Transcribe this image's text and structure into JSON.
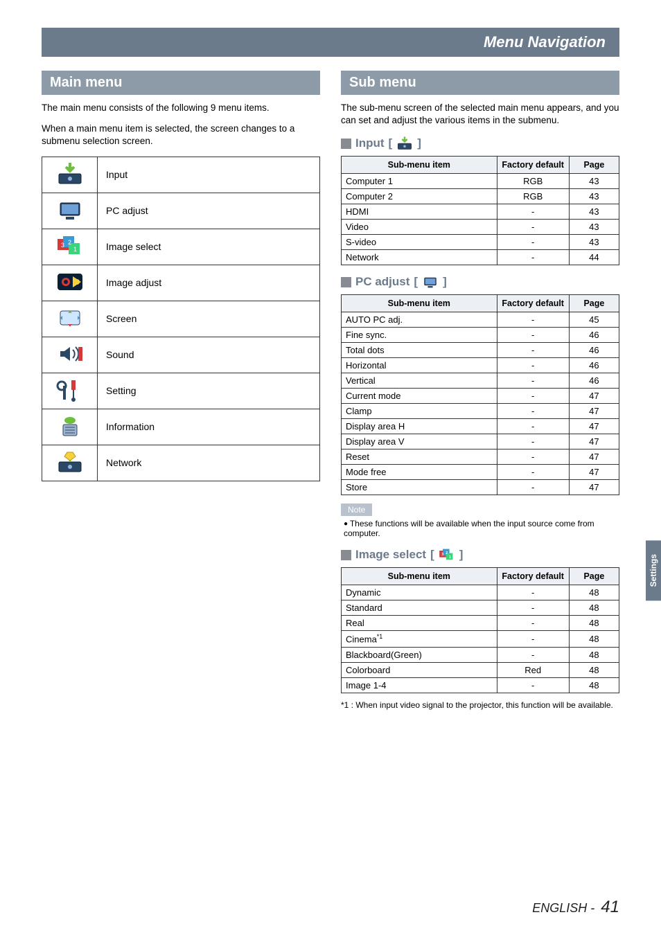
{
  "titlebar": "Menu Navigation",
  "side_tab": "Settings",
  "footer_lang": "ENGLISH -",
  "footer_page": "41",
  "main_menu": {
    "heading": "Main menu",
    "intro_a": "The main menu consists of the following 9 menu items.",
    "intro_b": "When a main menu item is selected, the screen changes to a submenu selection screen.",
    "items": [
      {
        "icon": "input-icon",
        "label": "Input"
      },
      {
        "icon": "pc-adjust-icon",
        "label": "PC adjust"
      },
      {
        "icon": "image-select-icon",
        "label": "Image select"
      },
      {
        "icon": "image-adjust-icon",
        "label": "Image adjust"
      },
      {
        "icon": "screen-icon",
        "label": "Screen"
      },
      {
        "icon": "sound-icon",
        "label": "Sound"
      },
      {
        "icon": "setting-icon",
        "label": "Setting"
      },
      {
        "icon": "information-icon",
        "label": "Information"
      },
      {
        "icon": "network-icon",
        "label": "Network"
      }
    ]
  },
  "sub_menu": {
    "heading": "Sub menu",
    "intro": "The sub-menu screen of the selected main menu appears, and you can set and adjust the various items in the submenu.",
    "table_headers": {
      "c1": "Sub-menu item",
      "c2": "Factory default",
      "c3": "Page"
    },
    "input": {
      "title": "Input",
      "rows": [
        {
          "item": "Computer 1",
          "def": "RGB",
          "page": "43"
        },
        {
          "item": "Computer 2",
          "def": "RGB",
          "page": "43"
        },
        {
          "item": "HDMI",
          "def": "-",
          "page": "43"
        },
        {
          "item": "Video",
          "def": "-",
          "page": "43"
        },
        {
          "item": "S-video",
          "def": "-",
          "page": "43"
        },
        {
          "item": "Network",
          "def": "-",
          "page": "44"
        }
      ]
    },
    "pc_adjust": {
      "title": "PC adjust",
      "rows": [
        {
          "item": "AUTO PC adj.",
          "def": "-",
          "page": "45"
        },
        {
          "item": "Fine sync.",
          "def": "-",
          "page": "46"
        },
        {
          "item": "Total dots",
          "def": "-",
          "page": "46"
        },
        {
          "item": "Horizontal",
          "def": "-",
          "page": "46"
        },
        {
          "item": "Vertical",
          "def": "-",
          "page": "46"
        },
        {
          "item": "Current mode",
          "def": "-",
          "page": "47"
        },
        {
          "item": "Clamp",
          "def": "-",
          "page": "47"
        },
        {
          "item": "Display area H",
          "def": "-",
          "page": "47"
        },
        {
          "item": "Display area V",
          "def": "-",
          "page": "47"
        },
        {
          "item": "Reset",
          "def": "-",
          "page": "47"
        },
        {
          "item": "Mode free",
          "def": "-",
          "page": "47"
        },
        {
          "item": "Store",
          "def": "-",
          "page": "47"
        }
      ],
      "note_label": "Note",
      "note_text": "These functions will be available when the input source come from computer."
    },
    "image_select": {
      "title": "Image select",
      "rows": [
        {
          "item": "Dynamic",
          "def": "-",
          "page": "48"
        },
        {
          "item": "Standard",
          "def": "-",
          "page": "48"
        },
        {
          "item": "Real",
          "def": "-",
          "page": "48"
        },
        {
          "item": "Cinema*1",
          "def": "-",
          "page": "48",
          "sup": true
        },
        {
          "item": "Blackboard(Green)",
          "def": "-",
          "page": "48"
        },
        {
          "item": "Colorboard",
          "def": "Red",
          "page": "48"
        },
        {
          "item": "Image 1-4",
          "def": "-",
          "page": "48"
        }
      ],
      "footnote": "*1 :   When input video signal to the projector, this function will be available."
    }
  }
}
